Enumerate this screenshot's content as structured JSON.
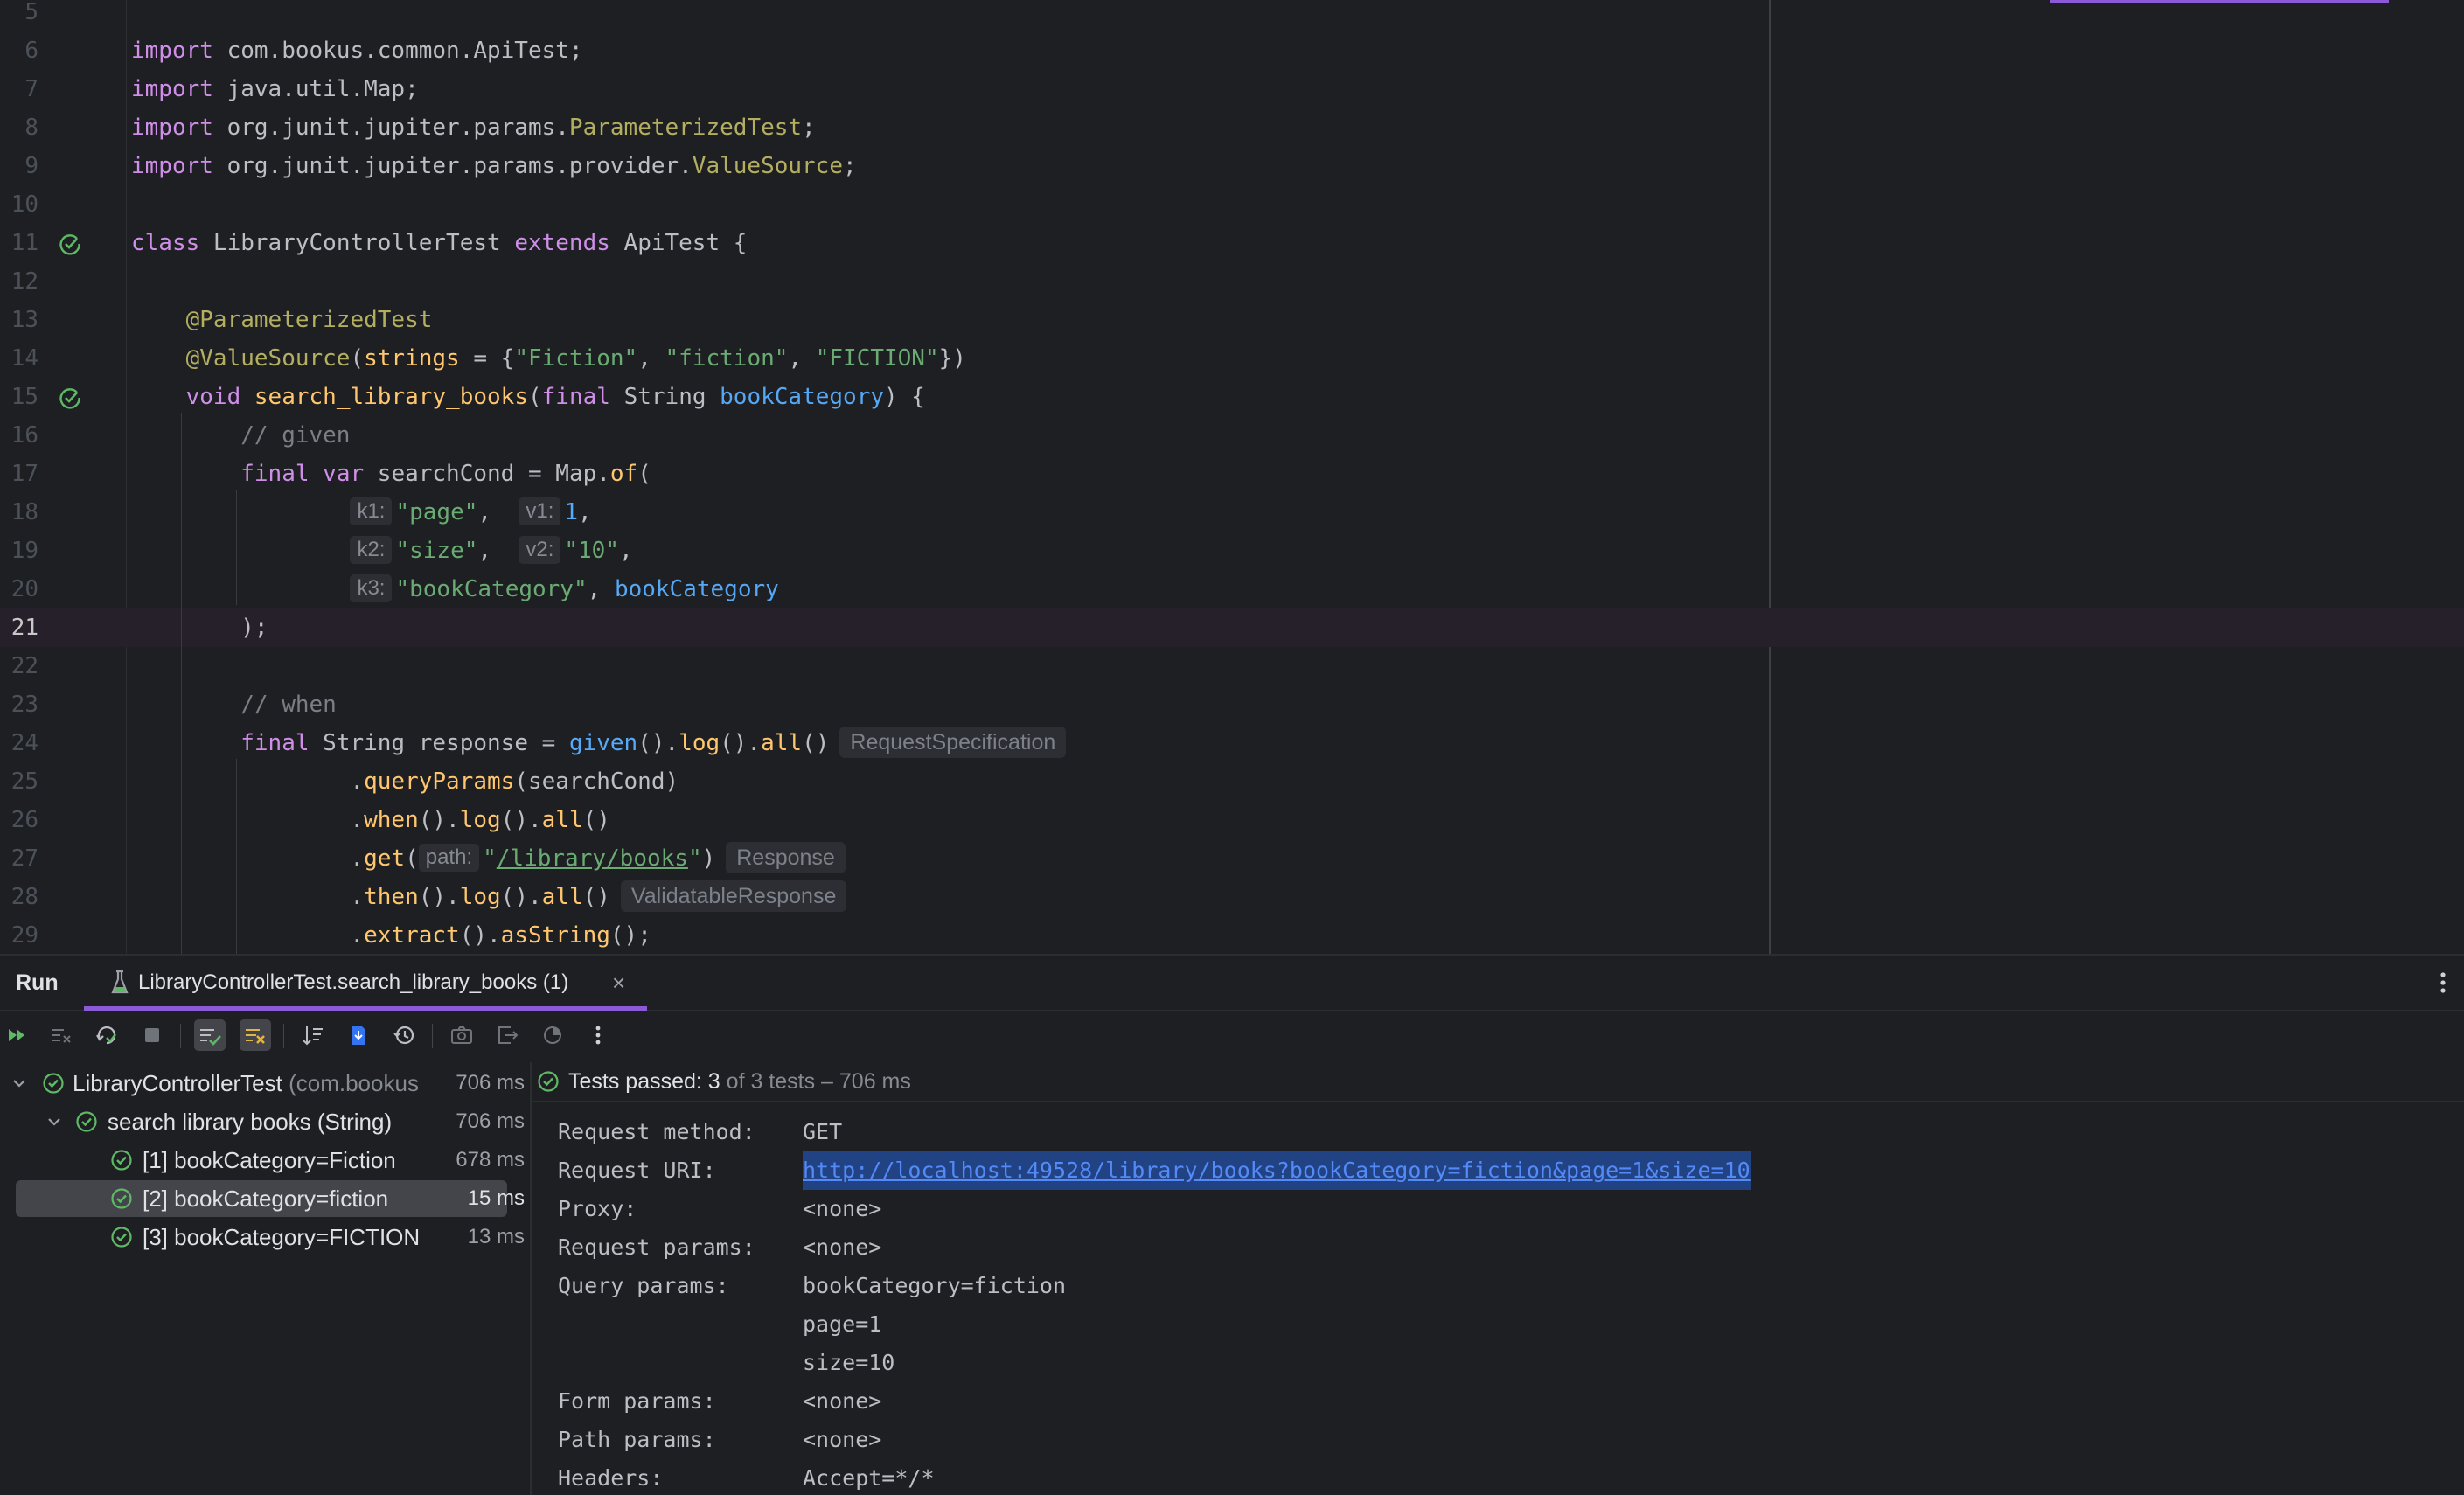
{
  "editor": {
    "lines": [
      {
        "n": "5",
        "parts": []
      },
      {
        "n": "6",
        "parts": [
          [
            "k",
            "import"
          ],
          [
            "p",
            " com.bookus.common.ApiTest;"
          ]
        ]
      },
      {
        "n": "7",
        "parts": [
          [
            "k",
            "import"
          ],
          [
            "p",
            " java.util.Map;"
          ]
        ]
      },
      {
        "n": "8",
        "parts": [
          [
            "k",
            "import"
          ],
          [
            "p",
            " org.junit.jupiter.params."
          ],
          [
            "a",
            "ParameterizedTest"
          ],
          [
            "p",
            ";"
          ]
        ]
      },
      {
        "n": "9",
        "parts": [
          [
            "k",
            "import"
          ],
          [
            "p",
            " org.junit.jupiter.params.provider."
          ],
          [
            "a",
            "ValueSource"
          ],
          [
            "p",
            ";"
          ]
        ]
      },
      {
        "n": "10",
        "parts": []
      },
      {
        "n": "11",
        "run_icon": true,
        "parts": [
          [
            "k",
            "class"
          ],
          [
            "p",
            " LibraryControllerTest "
          ],
          [
            "k",
            "extends"
          ],
          [
            "p",
            " ApiTest {"
          ]
        ]
      },
      {
        "n": "12",
        "parts": []
      },
      {
        "n": "13",
        "parts": [
          [
            "p",
            "    "
          ],
          [
            "a",
            "@ParameterizedTest"
          ]
        ]
      },
      {
        "n": "14",
        "parts": [
          [
            "p",
            "    "
          ],
          [
            "a",
            "@ValueSource"
          ],
          [
            "p",
            "("
          ],
          [
            "m",
            "strings"
          ],
          [
            "p",
            " = {"
          ],
          [
            "s",
            "\"Fiction\""
          ],
          [
            "p",
            ", "
          ],
          [
            "s",
            "\"fiction\""
          ],
          [
            "p",
            ", "
          ],
          [
            "s",
            "\"FICTION\""
          ],
          [
            "p",
            "})"
          ]
        ]
      },
      {
        "n": "15",
        "run_icon": true,
        "parts": [
          [
            "p",
            "    "
          ],
          [
            "k",
            "void"
          ],
          [
            "p",
            " "
          ],
          [
            "m",
            "search_library_books"
          ],
          [
            "p",
            "("
          ],
          [
            "k",
            "final"
          ],
          [
            "p",
            " String "
          ],
          [
            "pm",
            "bookCategory"
          ],
          [
            "p",
            ") {"
          ]
        ]
      },
      {
        "n": "16",
        "parts": [
          [
            "p",
            "        "
          ],
          [
            "c",
            "// given"
          ]
        ]
      },
      {
        "n": "17",
        "parts": [
          [
            "p",
            "        "
          ],
          [
            "k",
            "final"
          ],
          [
            "p",
            " "
          ],
          [
            "k",
            "var"
          ],
          [
            "p",
            " searchCond = Map."
          ],
          [
            "m",
            "of"
          ],
          [
            "p",
            "("
          ]
        ]
      },
      {
        "n": "18",
        "parts": [
          [
            "p",
            "                "
          ],
          [
            "h",
            "k1:"
          ],
          [
            "s",
            "\"page\""
          ],
          [
            "p",
            ",  "
          ],
          [
            "h",
            "v1:"
          ],
          [
            "f",
            "1"
          ],
          [
            "p",
            ","
          ]
        ]
      },
      {
        "n": "19",
        "parts": [
          [
            "p",
            "                "
          ],
          [
            "h",
            "k2:"
          ],
          [
            "s",
            "\"size\""
          ],
          [
            "p",
            ",  "
          ],
          [
            "h",
            "v2:"
          ],
          [
            "s",
            "\"10\""
          ],
          [
            "p",
            ","
          ]
        ]
      },
      {
        "n": "20",
        "parts": [
          [
            "p",
            "                "
          ],
          [
            "h",
            "k3:"
          ],
          [
            "s",
            "\"bookCategory\""
          ],
          [
            "p",
            ", "
          ],
          [
            "pm",
            "bookCategory"
          ]
        ]
      },
      {
        "n": "21",
        "current": true,
        "parts": [
          [
            "p",
            "        );"
          ]
        ]
      },
      {
        "n": "22",
        "parts": []
      },
      {
        "n": "23",
        "parts": [
          [
            "p",
            "        "
          ],
          [
            "c",
            "// when"
          ]
        ]
      },
      {
        "n": "24",
        "parts": [
          [
            "p",
            "        "
          ],
          [
            "k",
            "final"
          ],
          [
            "p",
            " String response = "
          ],
          [
            "f",
            "given"
          ],
          [
            "p",
            "()."
          ],
          [
            "m",
            "log"
          ],
          [
            "p",
            "()."
          ],
          [
            "m",
            "all"
          ],
          [
            "p",
            "()"
          ],
          [
            "ih",
            "RequestSpecification"
          ]
        ]
      },
      {
        "n": "25",
        "parts": [
          [
            "p",
            "                ."
          ],
          [
            "m",
            "queryParams"
          ],
          [
            "p",
            "(searchCond)"
          ]
        ]
      },
      {
        "n": "26",
        "parts": [
          [
            "p",
            "                ."
          ],
          [
            "m",
            "when"
          ],
          [
            "p",
            "()."
          ],
          [
            "m",
            "log"
          ],
          [
            "p",
            "()."
          ],
          [
            "m",
            "all"
          ],
          [
            "p",
            "()"
          ]
        ]
      },
      {
        "n": "27",
        "parts": [
          [
            "p",
            "                ."
          ],
          [
            "m",
            "get"
          ],
          [
            "p",
            "("
          ],
          [
            "h",
            "path:"
          ],
          [
            "s",
            "\""
          ],
          [
            "su",
            "/library/books"
          ],
          [
            "s",
            "\""
          ],
          [
            "p",
            ")"
          ],
          [
            "ih",
            "Response"
          ]
        ]
      },
      {
        "n": "28",
        "parts": [
          [
            "p",
            "                ."
          ],
          [
            "m",
            "then"
          ],
          [
            "p",
            "()."
          ],
          [
            "m",
            "log"
          ],
          [
            "p",
            "()."
          ],
          [
            "m",
            "all"
          ],
          [
            "p",
            "()"
          ],
          [
            "ih",
            "ValidatableResponse"
          ]
        ]
      },
      {
        "n": "29",
        "parts": [
          [
            "p",
            "                ."
          ],
          [
            "m",
            "extract"
          ],
          [
            "p",
            "()."
          ],
          [
            "m",
            "asString"
          ],
          [
            "p",
            "();"
          ]
        ]
      }
    ]
  },
  "run": {
    "label": "Run",
    "tab_label": "LibraryControllerTest.search_library_books (1)",
    "tab_close": "×",
    "tree": [
      {
        "label": "LibraryControllerTest",
        "pkg": " (com.bookus",
        "time": "706 ms",
        "expanded": true,
        "level": 0
      },
      {
        "label": "search library books (String)",
        "pkg": "",
        "time": "706 ms",
        "expanded": true,
        "level": 1
      },
      {
        "label": "[1] bookCategory=Fiction",
        "pkg": "",
        "time": "678 ms",
        "level": 2
      },
      {
        "label": "[2] bookCategory=fiction",
        "pkg": "",
        "time": "15 ms",
        "level": 2,
        "selected": true
      },
      {
        "label": "[3] bookCategory=FICTION",
        "pkg": "",
        "time": "13 ms",
        "level": 2
      }
    ],
    "status": {
      "passed": "Tests passed: 3",
      "rest": " of 3 tests – 706 ms"
    },
    "console": [
      {
        "key": "Request method:",
        "value": "GET"
      },
      {
        "key": "Request URI:",
        "value": "http://localhost:49528/library/books?bookCategory=fiction&page=1&size=10",
        "link": true
      },
      {
        "key": "Proxy:",
        "value": "<none>"
      },
      {
        "key": "Request params:",
        "value": "<none>"
      },
      {
        "key": "Query params:",
        "value": "bookCategory=fiction"
      },
      {
        "key": "",
        "value": "page=1"
      },
      {
        "key": "",
        "value": "size=10"
      },
      {
        "key": "Form params:",
        "value": "<none>"
      },
      {
        "key": "Path params:",
        "value": "<none>"
      },
      {
        "key": "Headers:",
        "value": "Accept=*/*"
      }
    ]
  },
  "colors": {
    "accent": "#8c5ad6",
    "passed": "#5fb865",
    "link": "#548af7"
  }
}
